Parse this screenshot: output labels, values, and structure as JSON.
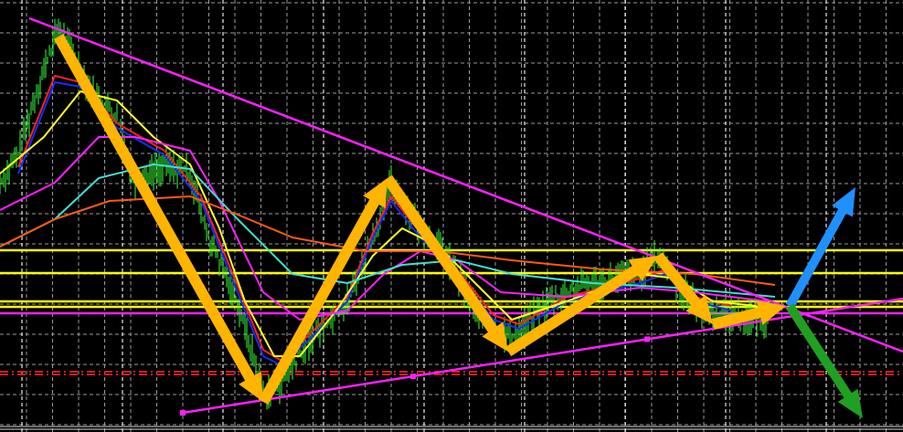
{
  "chart_data": {
    "type": "line",
    "title": "",
    "xlabel": "",
    "ylabel": "",
    "xlim": [
      0,
      247
    ],
    "ylim": [
      100,
      147.3
    ],
    "grid": true,
    "background": "#000000",
    "price": {
      "name": "price",
      "color": "#33ff33",
      "x": [
        0,
        5,
        10,
        16,
        20,
        25,
        32,
        37,
        45,
        52,
        57,
        65,
        72,
        77,
        85,
        95,
        102,
        107,
        115,
        122,
        132,
        140,
        150,
        162,
        175,
        180,
        185,
        192,
        200,
        210
      ],
      "y": [
        127.3,
        130.3,
        137.3,
        144.3,
        141.3,
        137.3,
        134.3,
        127.3,
        129.3,
        128.3,
        121.3,
        114.3,
        104.3,
        105.3,
        110.3,
        114.3,
        121.3,
        127.3,
        122.3,
        119.3,
        112.3,
        110.3,
        114.3,
        116.3,
        117.3,
        119.3,
        116.3,
        113.3,
        112.8,
        112.3
      ]
    },
    "series": [
      {
        "name": "ma-red",
        "color": "#ff2020",
        "x": [
          5,
          15,
          22,
          32,
          45,
          55,
          65,
          72,
          77,
          85,
          95,
          102,
          107,
          115,
          125,
          135,
          142,
          155,
          175,
          182,
          190,
          200
        ],
        "y": [
          129.0,
          139.0,
          138.3,
          133.8,
          130.8,
          125.8,
          116.0,
          109.0,
          107.8,
          110.8,
          114.8,
          121.8,
          125.8,
          121.8,
          117.8,
          112.8,
          111.8,
          114.8,
          116.8,
          117.8,
          114.8,
          113.8
        ]
      },
      {
        "name": "ma-blue",
        "color": "#1030ff",
        "x": [
          5,
          15,
          22,
          32,
          45,
          55,
          65,
          72,
          77,
          85,
          95,
          102,
          107,
          115,
          125,
          135,
          142,
          155,
          175,
          182,
          190,
          200
        ],
        "y": [
          128.3,
          138.3,
          137.8,
          133.3,
          130.3,
          125.3,
          115.3,
          108.3,
          107.3,
          110.3,
          114.3,
          121.3,
          125.3,
          121.3,
          117.3,
          112.3,
          111.3,
          114.3,
          116.3,
          117.3,
          114.3,
          113.3
        ]
      },
      {
        "name": "ma-yellow",
        "color": "#ffff20",
        "x": [
          0,
          12,
          22,
          32,
          42,
          52,
          60,
          67,
          75,
          82,
          92,
          102,
          110,
          120,
          130,
          140,
          155,
          175,
          185,
          195,
          207
        ],
        "y": [
          128.3,
          132.3,
          137.3,
          136.3,
          132.3,
          129.3,
          122.3,
          114.3,
          108.3,
          108.3,
          113.3,
          119.3,
          122.3,
          120.3,
          116.3,
          112.3,
          114.3,
          117.3,
          116.8,
          114.3,
          113.8
        ]
      },
      {
        "name": "ma-magenta",
        "color": "#ff20ff",
        "x": [
          0,
          15,
          27,
          37,
          52,
          60,
          72,
          82,
          95,
          105,
          115,
          125,
          137,
          155,
          175,
          190,
          210
        ],
        "y": [
          124.3,
          127.3,
          132.3,
          132.3,
          130.8,
          125.3,
          115.3,
          112.3,
          113.3,
          117.3,
          119.8,
          118.8,
          115.3,
          114.8,
          115.8,
          115.3,
          114.3
        ]
      },
      {
        "name": "ma-cyan",
        "color": "#40e0d0",
        "x": [
          0,
          15,
          27,
          42,
          52,
          65,
          80,
          95,
          110,
          125,
          140,
          162,
          185,
          212
        ],
        "y": [
          120.3,
          123.3,
          127.8,
          129.3,
          128.8,
          123.3,
          117.3,
          116.3,
          118.3,
          118.8,
          117.3,
          116.3,
          115.8,
          114.8
        ]
      },
      {
        "name": "ma-orange",
        "color": "#ff5a10",
        "x": [
          0,
          15,
          30,
          52,
          65,
          80,
          100,
          120,
          140,
          165,
          190,
          212
        ],
        "y": [
          120.3,
          123.3,
          125.3,
          125.8,
          123.8,
          121.3,
          119.8,
          119.8,
          118.8,
          117.8,
          117.3,
          116.1
        ]
      }
    ],
    "levels": [
      {
        "name": "level-yellow-1",
        "y": 119.9,
        "color": "#ffff00",
        "style": "solid"
      },
      {
        "name": "level-yellow-2",
        "y": 117.4,
        "color": "#ffff00",
        "style": "solid"
      },
      {
        "name": "level-yellow-3",
        "y": 114.3,
        "color": "#ffff00",
        "style": "solid"
      },
      {
        "name": "level-yellow-4",
        "y": 113.7,
        "color": "#ffff00",
        "style": "solid"
      },
      {
        "name": "level-magenta",
        "y": 113.0,
        "color": "#ff20ff",
        "style": "solid"
      },
      {
        "name": "level-red-1",
        "y": 106.6,
        "color": "#d02020",
        "style": "dashdot"
      },
      {
        "name": "level-red-2",
        "y": 106.3,
        "color": "#d02020",
        "style": "dashdot"
      }
    ],
    "trendlines": [
      {
        "name": "descending-trendline",
        "color": "#ff20ff",
        "x": [
          8,
          247
        ],
        "y": [
          145.3,
          108.8
        ],
        "markers": false
      },
      {
        "name": "ascending-trendline",
        "color": "#ff20ff",
        "x": [
          50,
          247
        ],
        "y": [
          102.1,
          114.6
        ],
        "markers": [
          50,
          113,
          177
        ]
      }
    ],
    "zigzag": {
      "color": "#ffb400",
      "x": [
        16,
        72,
        106,
        139,
        180,
        195,
        215
      ],
      "y": [
        143.3,
        103.3,
        127.8,
        108.8,
        119.3,
        111.8,
        113.8
      ]
    },
    "scenario_arrows": [
      {
        "name": "bullish-arrow",
        "color": "#2090ff",
        "x": [
          216,
          234
        ],
        "y": [
          113.8,
          126.8
        ]
      },
      {
        "name": "bearish-arrow",
        "color": "#20a020",
        "x": [
          216,
          236
        ],
        "y": [
          113.8,
          101.5
        ]
      }
    ]
  }
}
